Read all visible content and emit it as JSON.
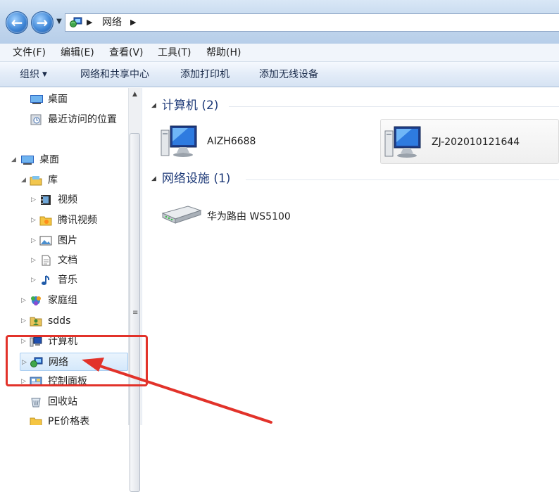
{
  "address": {
    "crumb": "网络"
  },
  "menu": [
    {
      "label": "文件(F)"
    },
    {
      "label": "编辑(E)"
    },
    {
      "label": "查看(V)"
    },
    {
      "label": "工具(T)"
    },
    {
      "label": "帮助(H)"
    }
  ],
  "toolbar": {
    "organize": "组织",
    "network_center": "网络和共享中心",
    "add_printer": "添加打印机",
    "add_wireless": "添加无线设备"
  },
  "nav": {
    "favorites": [
      {
        "label": "桌面",
        "icon": "desktop-icon"
      },
      {
        "label": "最近访问的位置",
        "icon": "recent-places-icon"
      }
    ],
    "tree": [
      {
        "label": "桌面",
        "icon": "desktop-icon",
        "level": 0,
        "expanded": true
      },
      {
        "label": "库",
        "icon": "library-icon",
        "level": 1,
        "expanded": true
      },
      {
        "label": "视频",
        "icon": "video-icon",
        "level": 2
      },
      {
        "label": "腾讯视频",
        "icon": "folder-icon",
        "level": 2
      },
      {
        "label": "图片",
        "icon": "pictures-icon",
        "level": 2
      },
      {
        "label": "文档",
        "icon": "documents-icon",
        "level": 2
      },
      {
        "label": "音乐",
        "icon": "music-icon",
        "level": 2
      },
      {
        "label": "家庭组",
        "icon": "homegroup-icon",
        "level": 1
      },
      {
        "label": "sdds",
        "icon": "user-folder-icon",
        "level": 1
      },
      {
        "label": "计算机",
        "icon": "computer-icon",
        "level": 1
      },
      {
        "label": "网络",
        "icon": "network-icon",
        "level": 1,
        "selected": true
      },
      {
        "label": "控制面板",
        "icon": "control-panel-icon",
        "level": 1
      },
      {
        "label": "回收站",
        "icon": "recycle-bin-icon",
        "level": 1
      },
      {
        "label": "PE价格表",
        "icon": "folder-icon",
        "level": 1
      }
    ]
  },
  "content": {
    "groups": [
      {
        "title": "计算机 (2)",
        "items": [
          {
            "label": "AIZH6688",
            "icon": "computer-icon"
          },
          {
            "label": "ZJ-202010121644",
            "icon": "computer-icon"
          }
        ]
      },
      {
        "title": "网络设施 (1)",
        "items": [
          {
            "label": "华为路由 WS5100",
            "icon": "router-icon"
          }
        ]
      }
    ]
  },
  "colors": {
    "annotation": "#e2322a",
    "group_title": "#1e3a78"
  }
}
